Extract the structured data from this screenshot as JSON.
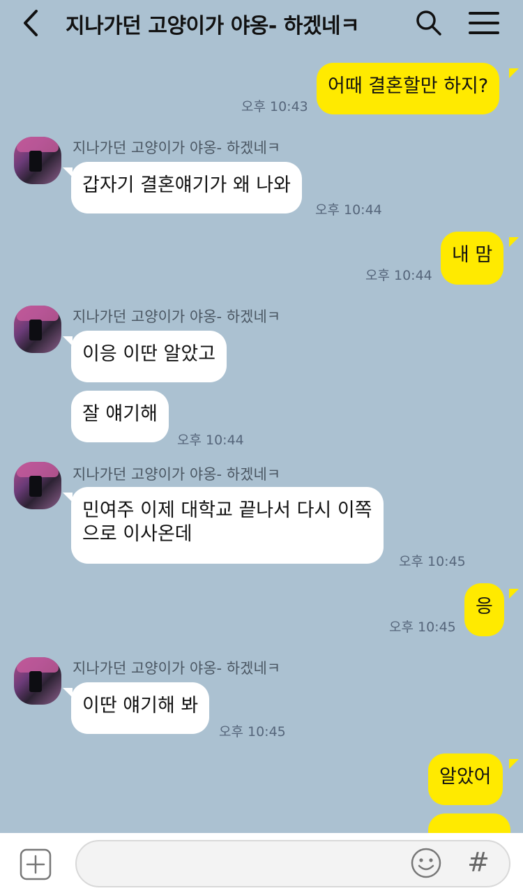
{
  "header": {
    "title": "지나가던 고양이가 야옹- 하겠네ㅋ"
  },
  "messages": [
    {
      "side": "mine",
      "text": "어때 결혼할만 하지?",
      "time": "오후 10:43"
    },
    {
      "side": "theirs",
      "sender": "지나가던 고양이가 야옹- 하겠네ㅋ",
      "text": "갑자기 결혼얘기가 왜 나와",
      "time": "오후 10:44"
    },
    {
      "side": "mine",
      "text": "내 맘",
      "time": "오후 10:44"
    },
    {
      "side": "theirs",
      "sender": "지나가던 고양이가 야옹- 하겠네ㅋ",
      "text": "이응 이딴 알았고"
    },
    {
      "side": "theirs",
      "text": "잘 얘기해",
      "time": "오후 10:44"
    },
    {
      "side": "theirs",
      "sender": "지나가던 고양이가 야옹- 하겠네ㅋ",
      "text_line1": "민여주 이제 대학교 끝나서 다시 이쪽",
      "text_line2": "으로 이사온데",
      "time": "오후 10:45"
    },
    {
      "side": "mine",
      "text": "응",
      "time": "오후 10:45"
    },
    {
      "side": "theirs",
      "sender": "지나가던 고양이가 야옹- 하겠네ㅋ",
      "text": "이딴 얘기해 봐",
      "time": "오후 10:45"
    },
    {
      "side": "mine",
      "text": "알았어"
    }
  ],
  "input": {
    "hash_label": "#"
  },
  "colors": {
    "background": "#abc1d1",
    "my_bubble": "#ffea00",
    "their_bubble": "#ffffff"
  }
}
